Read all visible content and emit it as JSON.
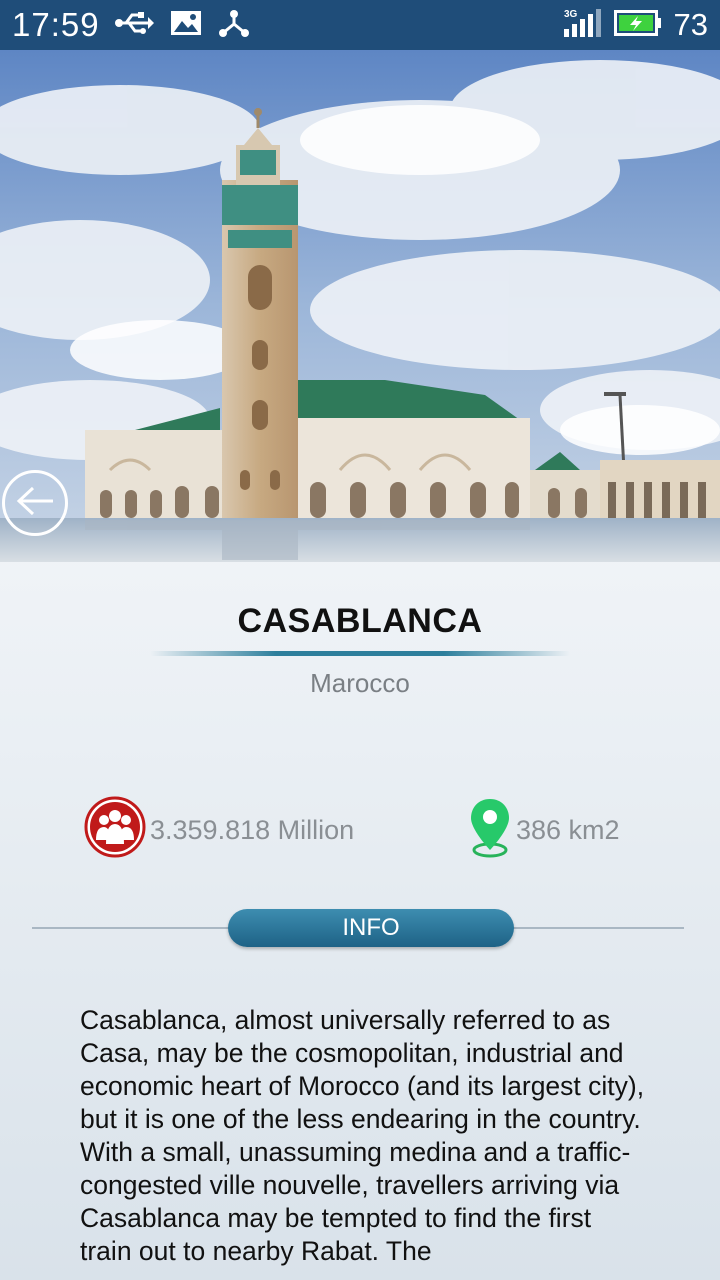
{
  "status_bar": {
    "time": "17:59",
    "icons_left": [
      "usb-icon",
      "image-icon",
      "share-icon"
    ],
    "network": "3G",
    "battery_level": "73"
  },
  "hero": {
    "back_icon": "arrow-left-icon"
  },
  "city": {
    "name": "CASABLANCA",
    "country": "Marocco",
    "population": "3.359.818 Million",
    "area": "386 km2",
    "population_icon": "people-icon",
    "area_icon": "location-pin-icon"
  },
  "info_tab": {
    "label": "INFO"
  },
  "description": "Casablanca, almost universally referred to as Casa, may be the cosmopolitan, industrial and economic heart of Morocco (and its largest city), but it is one of the less endearing in the country. With a small, unassuming medina and a traffic-congested ville nouvelle, travellers arriving via Casablanca may be tempted to find the first train out to nearby Rabat. The"
}
